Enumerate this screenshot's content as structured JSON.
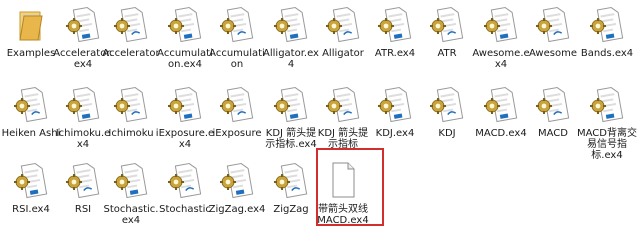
{
  "files": [
    {
      "label": "Examples",
      "icon": "folder-icon"
    },
    {
      "label": "Accelerator.ex4",
      "icon": "ex4-file-icon"
    },
    {
      "label": "Accelerator",
      "icon": "mq-indicator-icon"
    },
    {
      "label": "Accumulation.ex4",
      "icon": "ex4-file-icon"
    },
    {
      "label": "Accumulation",
      "icon": "mq-indicator-icon"
    },
    {
      "label": "Alligator.ex4",
      "icon": "ex4-file-icon"
    },
    {
      "label": "Alligator",
      "icon": "mq-indicator-icon"
    },
    {
      "label": "ATR.ex4",
      "icon": "ex4-file-icon"
    },
    {
      "label": "ATR",
      "icon": "mq-indicator-icon"
    },
    {
      "label": "Awesome.ex4",
      "icon": "ex4-file-icon"
    },
    {
      "label": "Awesome",
      "icon": "mq-indicator-icon"
    },
    {
      "label": "Bands.ex4",
      "icon": "ex4-file-icon"
    },
    {
      "label": "Heiken Ashi",
      "icon": "mq-indicator-icon"
    },
    {
      "label": "Ichimoku.ex4",
      "icon": "ex4-file-icon"
    },
    {
      "label": "Ichimoku",
      "icon": "mq-indicator-icon"
    },
    {
      "label": "iExposure.ex4",
      "icon": "ex4-file-icon"
    },
    {
      "label": "iExposure",
      "icon": "mq-indicator-icon"
    },
    {
      "label": "KDJ 箭头提示指标.ex4",
      "icon": "ex4-file-icon"
    },
    {
      "label": "KDJ 箭头提示指标",
      "icon": "mq-indicator-icon"
    },
    {
      "label": "KDJ.ex4",
      "icon": "ex4-file-icon"
    },
    {
      "label": "KDJ",
      "icon": "mq-indicator-icon"
    },
    {
      "label": "MACD.ex4",
      "icon": "ex4-file-icon"
    },
    {
      "label": "MACD",
      "icon": "mq-indicator-icon"
    },
    {
      "label": "MACD背离交易信号指标.ex4",
      "icon": "ex4-file-icon"
    },
    {
      "label": "RSI.ex4",
      "icon": "ex4-file-icon"
    },
    {
      "label": "RSI",
      "icon": "mq-indicator-icon"
    },
    {
      "label": "Stochastic.ex4",
      "icon": "ex4-file-icon"
    },
    {
      "label": "Stochastic",
      "icon": "mq-indicator-icon"
    },
    {
      "label": "ZigZag.ex4",
      "icon": "ex4-file-icon"
    },
    {
      "label": "ZigZag",
      "icon": "mq-indicator-icon"
    },
    {
      "label": "带箭头双线MACD.ex4",
      "icon": "blank-file-icon",
      "selected": true
    }
  ],
  "colors": {
    "selection_border": "#d12e2e",
    "folder": "#e8b64a",
    "mq_gold": "#c9a43a",
    "mq_blue": "#1f6fbf"
  }
}
